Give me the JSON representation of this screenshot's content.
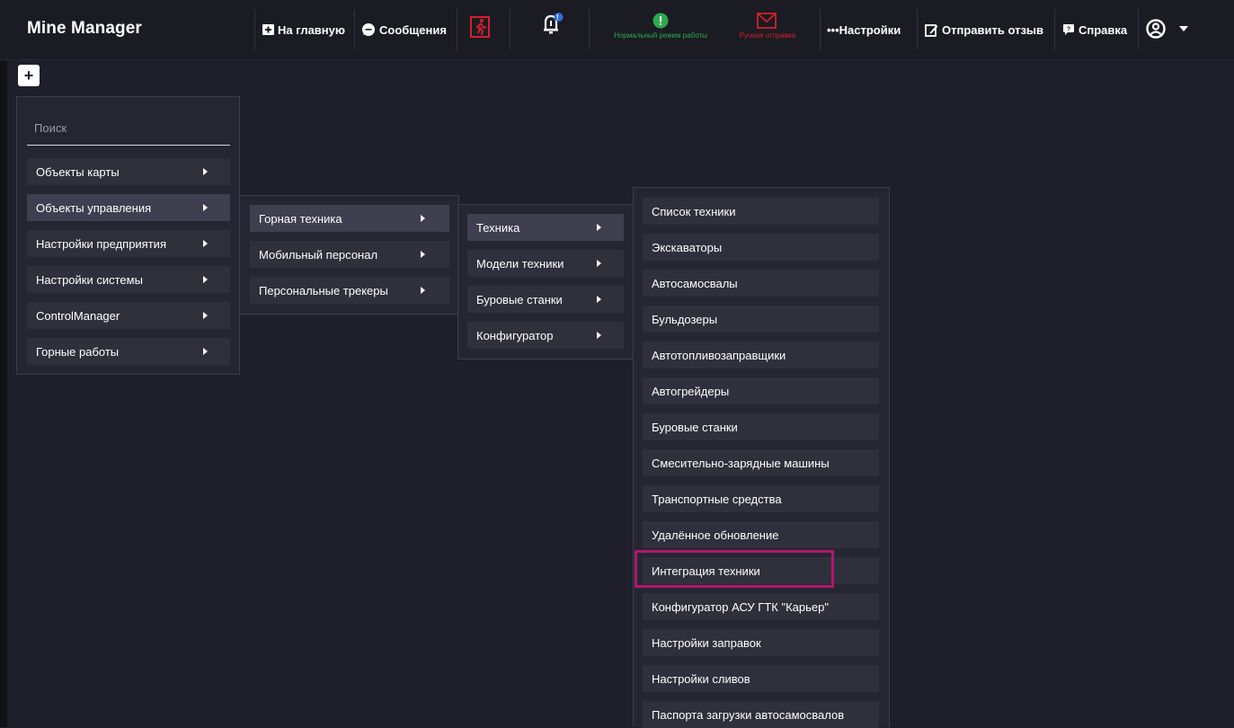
{
  "app": {
    "title": "Mine Manager"
  },
  "topbar": {
    "home_label": "На главную",
    "messages_label": "Сообщения",
    "notifications_badge": "!",
    "mode_status": "Нормальный режим работы",
    "send_status": "Ручная отправка",
    "settings_label": "•••Настройки",
    "feedback_label": "Отправить отзыв",
    "help_label": "Справка"
  },
  "colors": {
    "background": "#1f1f2b",
    "status_ok": "#2fa84f",
    "status_alert": "#d41f2a",
    "highlight": "#b0176e"
  },
  "search": {
    "placeholder": "Поиск"
  },
  "menu1": {
    "items": [
      {
        "label": "Объекты карты"
      },
      {
        "label": "Объекты управления"
      },
      {
        "label": "Настройки предприятия"
      },
      {
        "label": "Настройки системы"
      },
      {
        "label": "ControlManager"
      },
      {
        "label": "Горные работы"
      }
    ]
  },
  "menu2": {
    "items": [
      {
        "label": "Горная техника"
      },
      {
        "label": "Мобильный персонал"
      },
      {
        "label": "Персональные трекеры"
      }
    ]
  },
  "menu3": {
    "items": [
      {
        "label": "Техника"
      },
      {
        "label": "Модели техники"
      },
      {
        "label": "Буровые станки"
      },
      {
        "label": "Конфигуратор"
      }
    ]
  },
  "menu4": {
    "items": [
      {
        "label": "Список техники"
      },
      {
        "label": "Экскаваторы"
      },
      {
        "label": "Автосамосвалы"
      },
      {
        "label": "Бульдозеры"
      },
      {
        "label": "Автотопливозаправщики"
      },
      {
        "label": "Автогрейдеры"
      },
      {
        "label": "Буровые станки"
      },
      {
        "label": "Смесительно-зарядные машины"
      },
      {
        "label": "Транспортные средства"
      },
      {
        "label": "Удалённое обновление"
      },
      {
        "label": "Интеграция техники"
      },
      {
        "label": "Конфигуратор АСУ ГТК \"Карьер\""
      },
      {
        "label": "Настройки заправок"
      },
      {
        "label": "Настройки сливов"
      },
      {
        "label": "Паспорта загрузки автосамосвалов"
      }
    ]
  }
}
